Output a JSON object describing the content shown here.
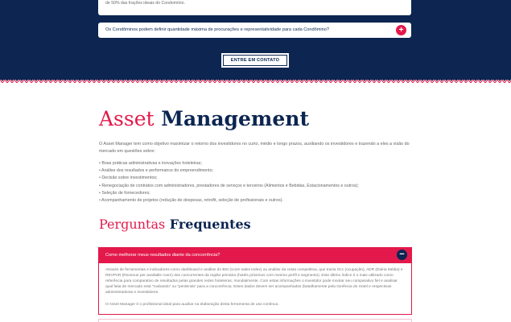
{
  "top_card": {
    "text": "de 50% das frações ideais do Condomínio."
  },
  "faq_top": {
    "question": "Os Condôminos podem definir quantidade máxima de procurações e representatividade para cada Condômino?",
    "toggle": "+"
  },
  "contact_button": "ENTRE EM CONTATO",
  "asset": {
    "title_light": "Asset",
    "title_bold": "Management",
    "intro": "O Asset Manager tem como objetivo maximizar o retorno dos investidores no curto, médio e longo prazos, auxiliando os investidores e trazendo a eles a visão do mercado em questões sobre:",
    "bullets": [
      "• Boas práticas administrativas e inovações hoteleiras;",
      "• Análise dos resultados e performance do empreendimento;",
      "• Decisão sobre investimentos;",
      "• Renegociação de contratos com administradores, prestadores de serviços e terceiros (Alimentos e Bebidas, Estacionamentos e outros);",
      "• Seleção de fornecedores;",
      "• Acompanhamento de projetos (redução de despesas, retrofit, seleção de profissionais e outros)."
    ]
  },
  "faq": {
    "title_light": "Perguntas",
    "title_bold": "Frequentes",
    "items": [
      {
        "question": "Como melhorar meus resultados diante da concorrência?",
        "toggle": "−",
        "answer_1": "Através de ferramentas e indicadores como dashboard e análise do BSI (vcom sales index) ou análise da cesta competitiva, que trazia Occ (ocupação), ADR (Diária Média) e REVPAR (Revenue per available room) dos concorrentes da região primária (hotéis próximos com mesmo perfil e segmento). Este último índice é o mais utilizado como referência para comparativo de resultados pelas grandes redes hoteleiras, mundialmente. Com estas informações o investidor pode montar seu comparativo fiel e analisar qual fatia de mercado está “roubando” ou “perdendo” para a concorrência. Estes dados devem ser acompanhados (batalhamente pela Gerência do Hotel e respectivas administradoras e investidores.",
        "answer_2": "O Asset Manager é o profissional ideal para auxiliar na elaboração desta ferramenta de uso contínuo."
      }
    ]
  },
  "colors": {
    "navy": "#0c2551",
    "accent": "#e3194b"
  }
}
